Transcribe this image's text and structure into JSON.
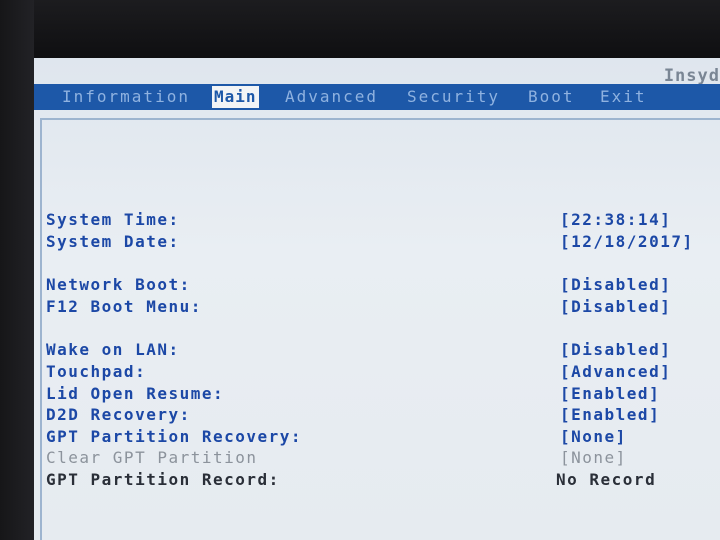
{
  "vendor": "Insyd",
  "menu": {
    "tabs": [
      "Information",
      "Main",
      "Advanced",
      "Security",
      "Boot",
      "Exit"
    ],
    "active": "Main"
  },
  "settings": [
    {
      "label": "System Time:",
      "value": "[22:38:14]"
    },
    {
      "label": "System Date:",
      "value": "[12/18/2017]"
    },
    {
      "label": "Network Boot:",
      "value": "[Disabled]"
    },
    {
      "label": "F12 Boot Menu:",
      "value": "[Disabled]"
    },
    {
      "label": "Wake on LAN:",
      "value": "[Disabled]"
    },
    {
      "label": "Touchpad:",
      "value": "[Advanced]"
    },
    {
      "label": "Lid Open Resume:",
      "value": "[Enabled]"
    },
    {
      "label": "D2D Recovery:",
      "value": "[Enabled]"
    },
    {
      "label": "GPT Partition Recovery:",
      "value": "[None]"
    },
    {
      "label": "Clear GPT Partition",
      "value": "[None]"
    },
    {
      "label": "GPT Partition Record:",
      "value": "No Record"
    }
  ],
  "colors": {
    "menubar": "#1d58a8",
    "label_blue": "#1c48a6",
    "value_white": "#f6f8fa",
    "disabled_gray": "#8c939c"
  }
}
